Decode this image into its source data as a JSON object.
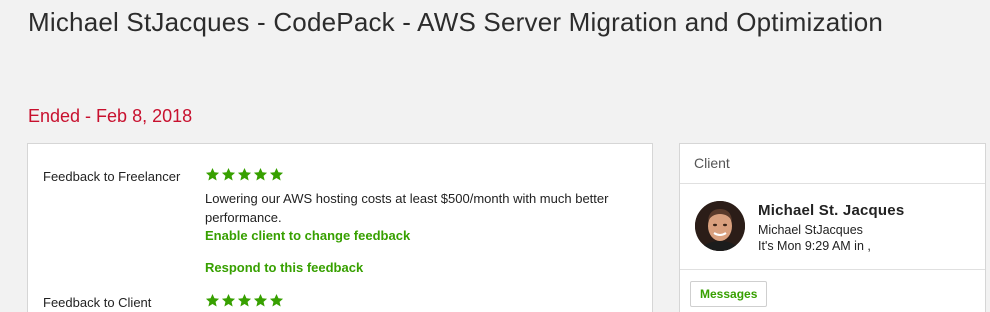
{
  "header": {
    "title": "Michael StJacques - CodePack - AWS Server Migration and Optimization",
    "status": "Ended - Feb 8, 2018"
  },
  "feedback": {
    "to_freelancer": {
      "label": "Feedback to Freelancer",
      "rating": 5,
      "comment": "Lowering our AWS hosting costs at least $500/month with much better performance.",
      "enable_link": "Enable client to change feedback",
      "respond_link": "Respond to this feedback"
    },
    "to_client": {
      "label": "Feedback to Client",
      "rating": 5
    }
  },
  "client": {
    "header": "Client",
    "name": "Michael St. Jacques",
    "username": "Michael StJacques",
    "local_time": "It's Mon 9:29 AM in ,",
    "messages_button": "Messages"
  },
  "colors": {
    "status": "#c8102e",
    "accent_green": "#37a000",
    "star": "#37a000"
  },
  "icons": {
    "star": "star-icon",
    "avatar": "avatar"
  }
}
